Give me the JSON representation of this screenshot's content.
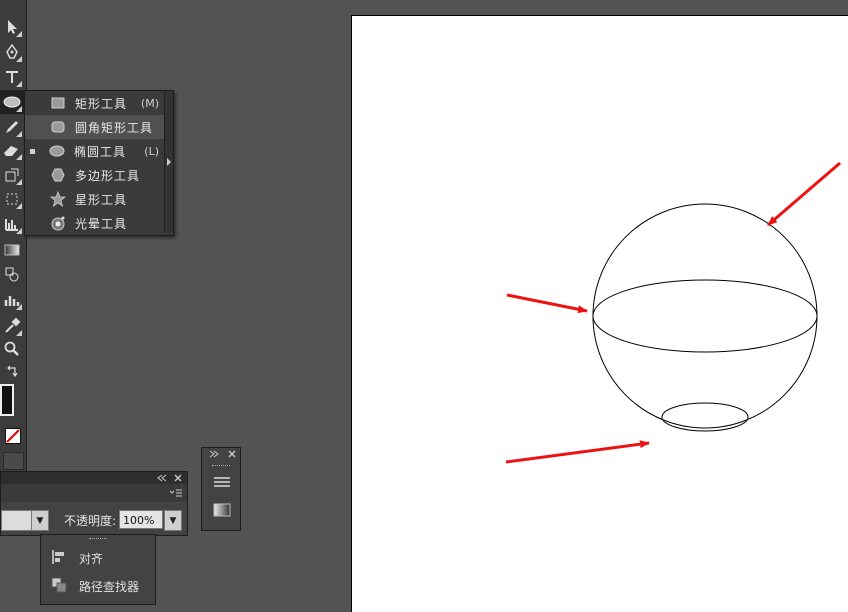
{
  "shape_menu": {
    "items": [
      {
        "label": "矩形工具",
        "shortcut": "(M)",
        "icon": "rectangle-icon",
        "selected": false
      },
      {
        "label": "圆角矩形工具",
        "shortcut": "",
        "icon": "rounded-rectangle-icon",
        "selected": false
      },
      {
        "label": "椭圆工具",
        "shortcut": "(L)",
        "icon": "ellipse-icon",
        "selected": true
      },
      {
        "label": "多边形工具",
        "shortcut": "",
        "icon": "polygon-icon",
        "selected": false
      },
      {
        "label": "星形工具",
        "shortcut": "",
        "icon": "star-icon",
        "selected": false
      },
      {
        "label": "光晕工具",
        "shortcut": "",
        "icon": "flare-icon",
        "selected": false
      }
    ]
  },
  "control_panel": {
    "opacity_label": "不透明度:",
    "opacity_value": "100%"
  },
  "side_panel": {
    "items": [
      {
        "label": "对齐",
        "icon": "align-icon"
      },
      {
        "label": "路径查找器",
        "icon": "pathfinder-icon"
      }
    ]
  },
  "colors": {
    "arrow": "#ee1111",
    "workspace": "#535353",
    "artboard": "#ffffff"
  }
}
